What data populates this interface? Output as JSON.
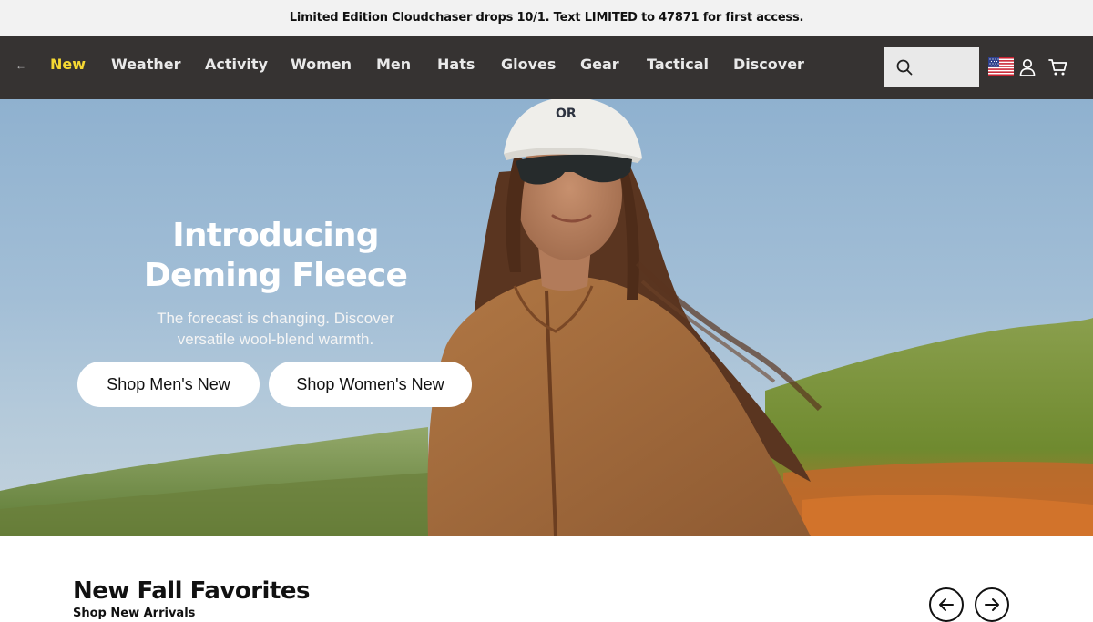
{
  "promo": {
    "text": "Limited Edition Cloudchaser drops 10/1. Text LIMITED to 47871 for first access."
  },
  "nav": {
    "back": "←",
    "links": [
      "New",
      "Weather",
      "Activity",
      "Women",
      "Men",
      "Hats",
      "Gloves",
      "Gear",
      "Tactical",
      "Discover"
    ],
    "active": "New",
    "search_placeholder": "",
    "icons": [
      "search-icon",
      "us-flag-icon",
      "account-icon",
      "cart-icon"
    ]
  },
  "hero": {
    "title_line1": "Introducing",
    "title_line2": "Deming Fleece",
    "subtitle_line1": "The forecast is changing. Discover",
    "subtitle_line2": "versatile wool-blend warmth.",
    "cta_men": "Shop Men's New",
    "cta_women": "Shop Women's New",
    "cap_logo": "OR"
  },
  "section": {
    "title": "New Fall Favorites",
    "link": "Shop New Arrivals",
    "prev_icon": "arrow-left-icon",
    "next_icon": "arrow-right-icon"
  },
  "colors": {
    "nav_bg": "#363332",
    "nav_active": "#f5d833",
    "promo_bg": "#f2f2f2"
  }
}
